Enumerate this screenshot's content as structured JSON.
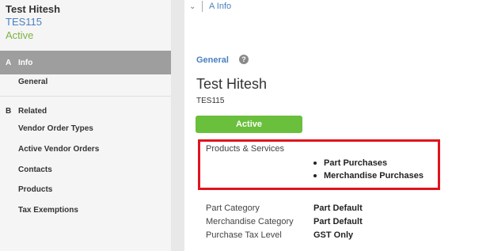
{
  "sidebar": {
    "entity_name": "Test Hitesh",
    "entity_code": "TES115",
    "entity_status": "Active",
    "sections": [
      {
        "letter": "A",
        "label": "Info",
        "items": [
          "General"
        ]
      },
      {
        "letter": "B",
        "label": "Related",
        "items": [
          "Vendor Order Types",
          "Active Vendor Orders",
          "Contacts",
          "Products",
          "Tax Exemptions"
        ]
      }
    ]
  },
  "breadcrumb": {
    "chevron": "⌄",
    "label": "A Info"
  },
  "main": {
    "section_link": "General",
    "help_icon": "?",
    "title": "Test Hitesh",
    "code": "TES115",
    "status_button": "Active",
    "products_services_label": "Products & Services",
    "products_services": [
      "Part Purchases",
      "Merchandise Purchases"
    ],
    "fields": [
      {
        "label": "Part Category",
        "value": "Part Default"
      },
      {
        "label": "Merchandise Category",
        "value": "Part Default"
      },
      {
        "label": "Purchase Tax Level",
        "value": "GST Only"
      }
    ]
  },
  "colors": {
    "accent_blue": "#4a7fc1",
    "active_green": "#6abf3c",
    "highlight_red": "#e0141e",
    "sidebar_active": "#9e9e9e"
  }
}
